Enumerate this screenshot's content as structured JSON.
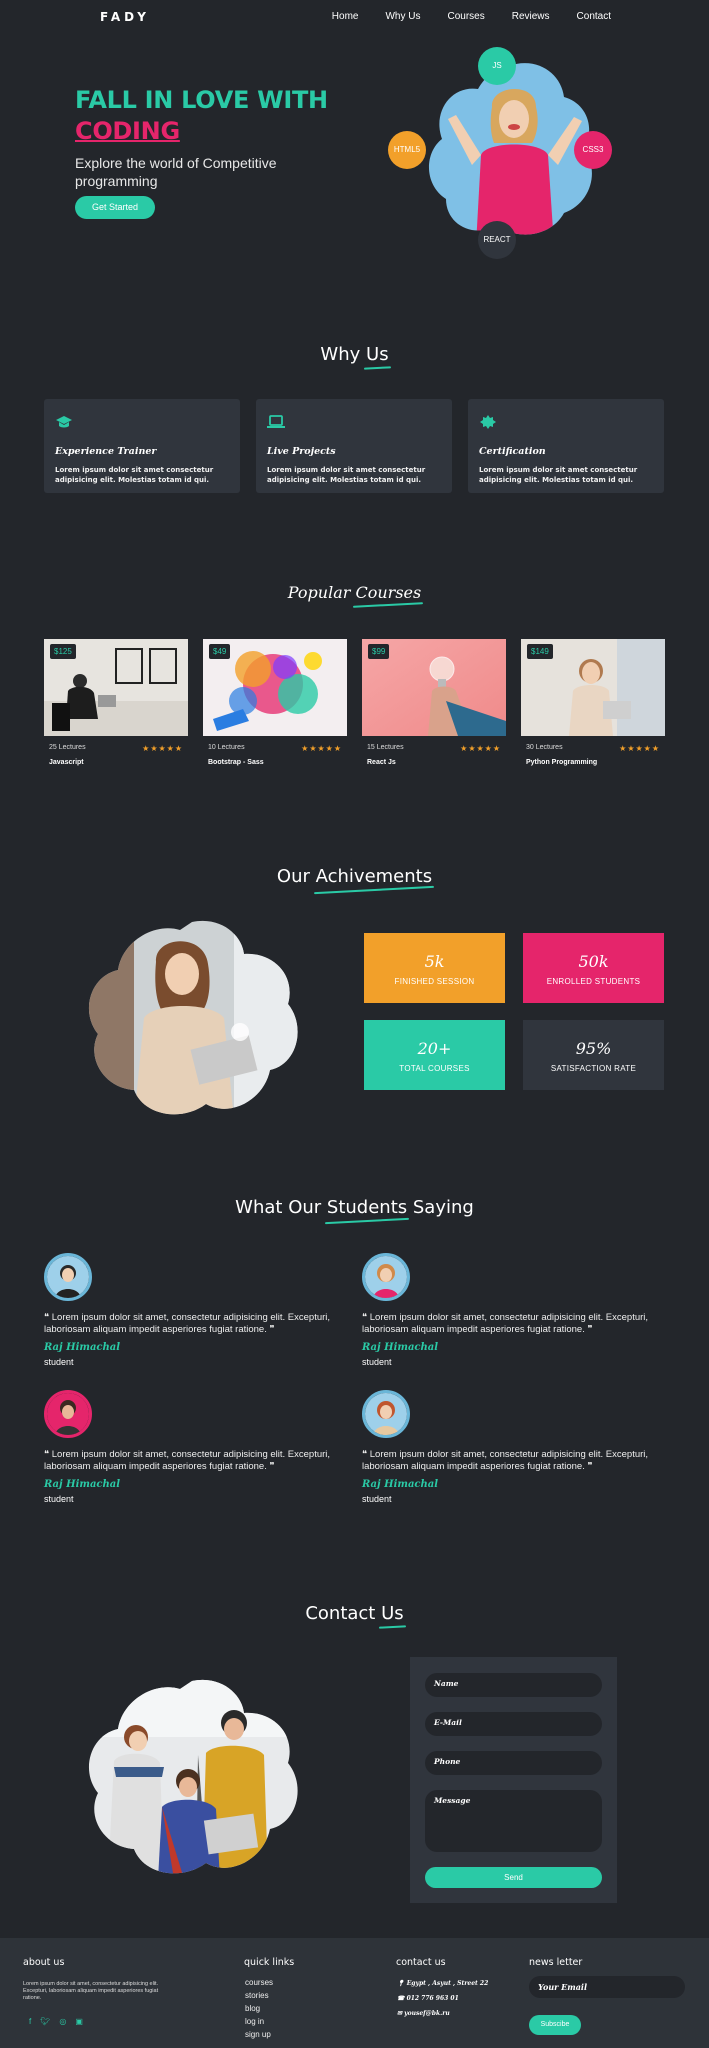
{
  "nav": {
    "logo": "FADY",
    "links": [
      "Home",
      "Why Us",
      "Courses",
      "Reviews",
      "Contact"
    ]
  },
  "hero": {
    "title": "FALL IN LOVE WITH",
    "highlight": "CODING",
    "subtitle": "Explore the world of Competitive programming",
    "cta": "Get Started",
    "bubbles": [
      {
        "label": "JS",
        "color": "#2acaa6"
      },
      {
        "label": "HTML5",
        "color": "#f2a02a"
      },
      {
        "label": "CSS3",
        "color": "#e5256b"
      },
      {
        "label": "REACT",
        "color": "#30353d"
      }
    ]
  },
  "why": {
    "title_a": "Why ",
    "title_b": "Us",
    "cards": [
      {
        "icon": "graduation-cap-icon",
        "title": "Experience Trainer",
        "text": "Lorem ipsum dolor sit amet consectetur adipisicing elit. Molestias totam id qui."
      },
      {
        "icon": "laptop-icon",
        "title": "Live Projects",
        "text": "Lorem ipsum dolor sit amet consectetur adipisicing elit. Molestias totam id qui."
      },
      {
        "icon": "certificate-icon",
        "title": "Certification",
        "text": "Lorem ipsum dolor sit amet consectetur adipisicing elit. Molestias totam id qui."
      }
    ]
  },
  "courses": {
    "title_a": "Popular ",
    "title_b": "Courses",
    "stars": "★★★★★",
    "items": [
      {
        "price": "$125",
        "lectures": "25 Lectures",
        "name": "Javascript",
        "rating": 5
      },
      {
        "price": "$49",
        "lectures": "10 Lectures",
        "name": "Bootstrap - Sass",
        "rating": 5
      },
      {
        "price": "$99",
        "lectures": "15 Lectures",
        "name": "React Js",
        "rating": 5
      },
      {
        "price": "$149",
        "lectures": "30 Lectures",
        "name": "Python Programming",
        "rating": 5
      }
    ]
  },
  "achievements": {
    "title_a": "Our ",
    "title_b": "Achivements",
    "stats": [
      {
        "value": "5k",
        "label": "FINISHED SESSION",
        "color": "#f2a02a"
      },
      {
        "value": "50k",
        "label": "ENROLLED STUDENTS",
        "color": "#e5256b"
      },
      {
        "value": "20+",
        "label": "TOTAL COURSES",
        "color": "#2acaa6"
      },
      {
        "value": "95%",
        "label": "SATISFACTION RATE",
        "color": "#30353d"
      }
    ]
  },
  "testimonials": {
    "title_a": "What Our ",
    "title_b": "Students",
    "title_c": " Saying",
    "items": [
      {
        "quote": "Lorem ipsum dolor sit amet, consectetur adipisicing elit. Excepturi, laboriosam aliquam impedit asperiores fugiat ratione.",
        "name": "Raj Himachal",
        "role": "student"
      },
      {
        "quote": "Lorem ipsum dolor sit amet, consectetur adipisicing elit. Excepturi, laboriosam aliquam impedit asperiores fugiat ratione.",
        "name": "Raj Himachal",
        "role": "student"
      },
      {
        "quote": "Lorem ipsum dolor sit amet, consectetur adipisicing elit. Excepturi, laboriosam aliquam impedit asperiores fugiat ratione.",
        "name": "Raj Himachal",
        "role": "student"
      },
      {
        "quote": "Lorem ipsum dolor sit amet, consectetur adipisicing elit. Excepturi, laboriosam aliquam impedit asperiores fugiat ratione.",
        "name": "Raj Himachal",
        "role": "student"
      }
    ]
  },
  "contact": {
    "title_a": "Contact ",
    "title_b": "Us",
    "fields": {
      "name": "Name",
      "email": "E-Mail",
      "phone": "Phone",
      "message": "Message"
    },
    "send": "Send"
  },
  "footer": {
    "about_h": "about us",
    "about_text": "Lorem ipsum dolor sit amet, consectetur adipisicing elit. Excepturi, laboriosam aliquam impedit asperiores fugiat ratione.",
    "links_h": "quick links",
    "links": [
      "courses",
      "stories",
      "blog",
      "log in",
      "sign up"
    ],
    "contact_h": "contact us",
    "address": "Egypt , Asyut , Street 22",
    "phone": "012 776 963 01",
    "email": "yousef@bk.ru",
    "news_h": "news letter",
    "news_placeholder": "Your Email",
    "subscribe": "Subscibe",
    "accent": "#2acaa6"
  }
}
